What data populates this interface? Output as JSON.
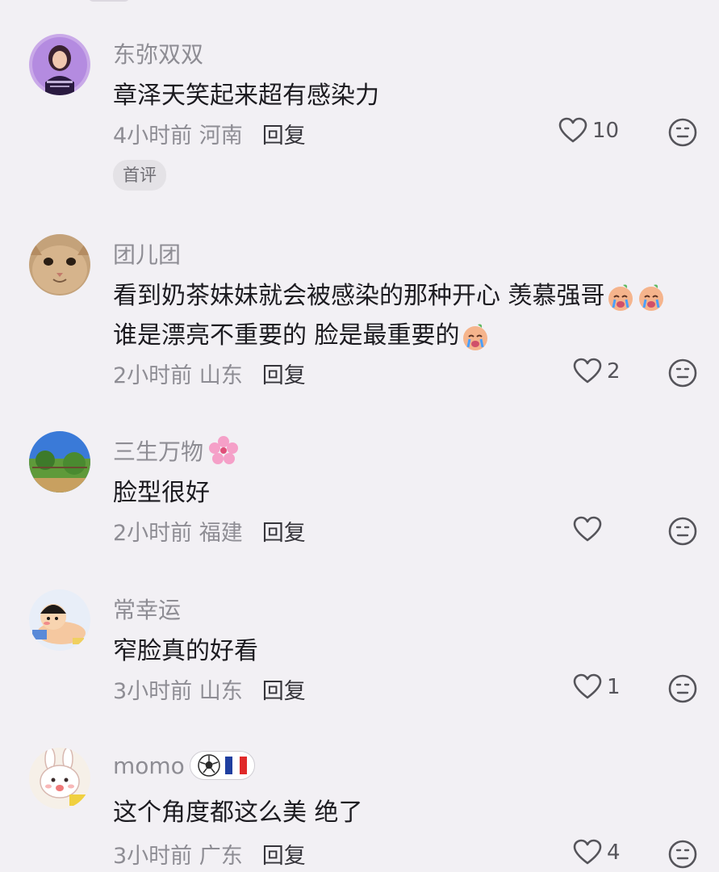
{
  "comments": [
    {
      "username": "东弥双双",
      "lines": [
        "章泽天笑起来超有感染力"
      ],
      "time": "4小时前",
      "location": "河南",
      "reply": "回复",
      "likes": "10",
      "badge": "首评",
      "avatar": "avatar-woman-purple"
    },
    {
      "username": "团儿团",
      "lines": [
        "看到奶茶妹妹就会被感染的那种开心 羡慕强哥",
        "谁是漂亮不重要的 脸是最重要的"
      ],
      "time": "2小时前",
      "location": "山东",
      "reply": "回复",
      "likes": "2",
      "avatar": "avatar-cat"
    },
    {
      "username": "三生万物",
      "lines": [
        "脸型很好"
      ],
      "time": "2小时前",
      "location": "福建",
      "reply": "回复",
      "likes": "",
      "avatar": "avatar-landscape"
    },
    {
      "username": "常幸运",
      "lines": [
        "窄脸真的好看"
      ],
      "time": "3小时前",
      "location": "山东",
      "reply": "回复",
      "likes": "1",
      "avatar": "avatar-cartoon-boy"
    },
    {
      "username": "momo",
      "lines": [
        "这个角度都这么美 绝了"
      ],
      "time": "3小时前",
      "location": "广东",
      "reply": "回复",
      "likes": "4",
      "avatar": "avatar-bunny"
    }
  ],
  "colors": {
    "background": "#f2f0f4",
    "muted_text": "#8e8d94",
    "primary_text": "#1c1b20"
  }
}
